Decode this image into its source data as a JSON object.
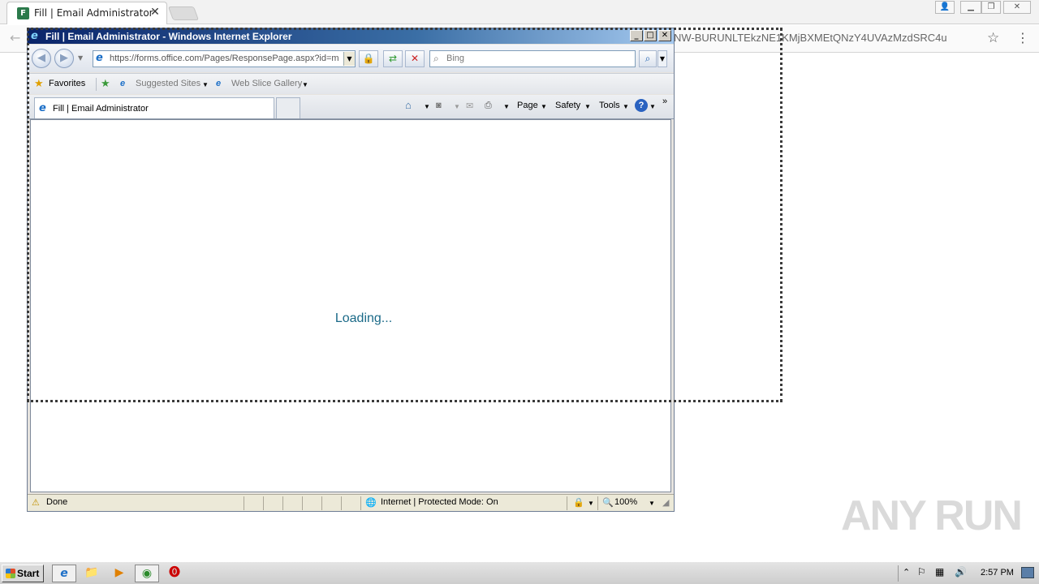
{
  "chrome": {
    "tab_title": "Fill | Email Administrator",
    "tab_favicon": "F",
    "tab_close": "✕",
    "url_tail": "NW-BURUNLTEkzNE1KMjBXMEtQNzY4UVAzMzdSRC4u",
    "star_icon": "☆",
    "menu_icon": "⋮",
    "back_icon": "←"
  },
  "ie": {
    "window_title": "Fill | Email Administrator - Windows Internet Explorer",
    "address": "https://forms.office.com/Pages/ResponsePage.aspx?id=mc",
    "search_placeholder": "Bing",
    "favorites_label": "Favorites",
    "suggested_sites_label": "Suggested Sites",
    "web_slice_label": "Web Slice Gallery",
    "tab_title": "Fill | Email Administrator",
    "commands": {
      "page": "Page",
      "safety": "Safety",
      "tools": "Tools"
    },
    "content_loading": "Loading...",
    "status": {
      "done": "Done",
      "zone": "Internet | Protected Mode: On",
      "zoom": "100%"
    }
  },
  "taskbar": {
    "start_label": "Start",
    "time": "2:57 PM"
  },
  "watermark": "ANY RUN",
  "colors": {
    "ie_title_gradient_start": "#0a246a",
    "loading_text": "#1b6a88"
  }
}
